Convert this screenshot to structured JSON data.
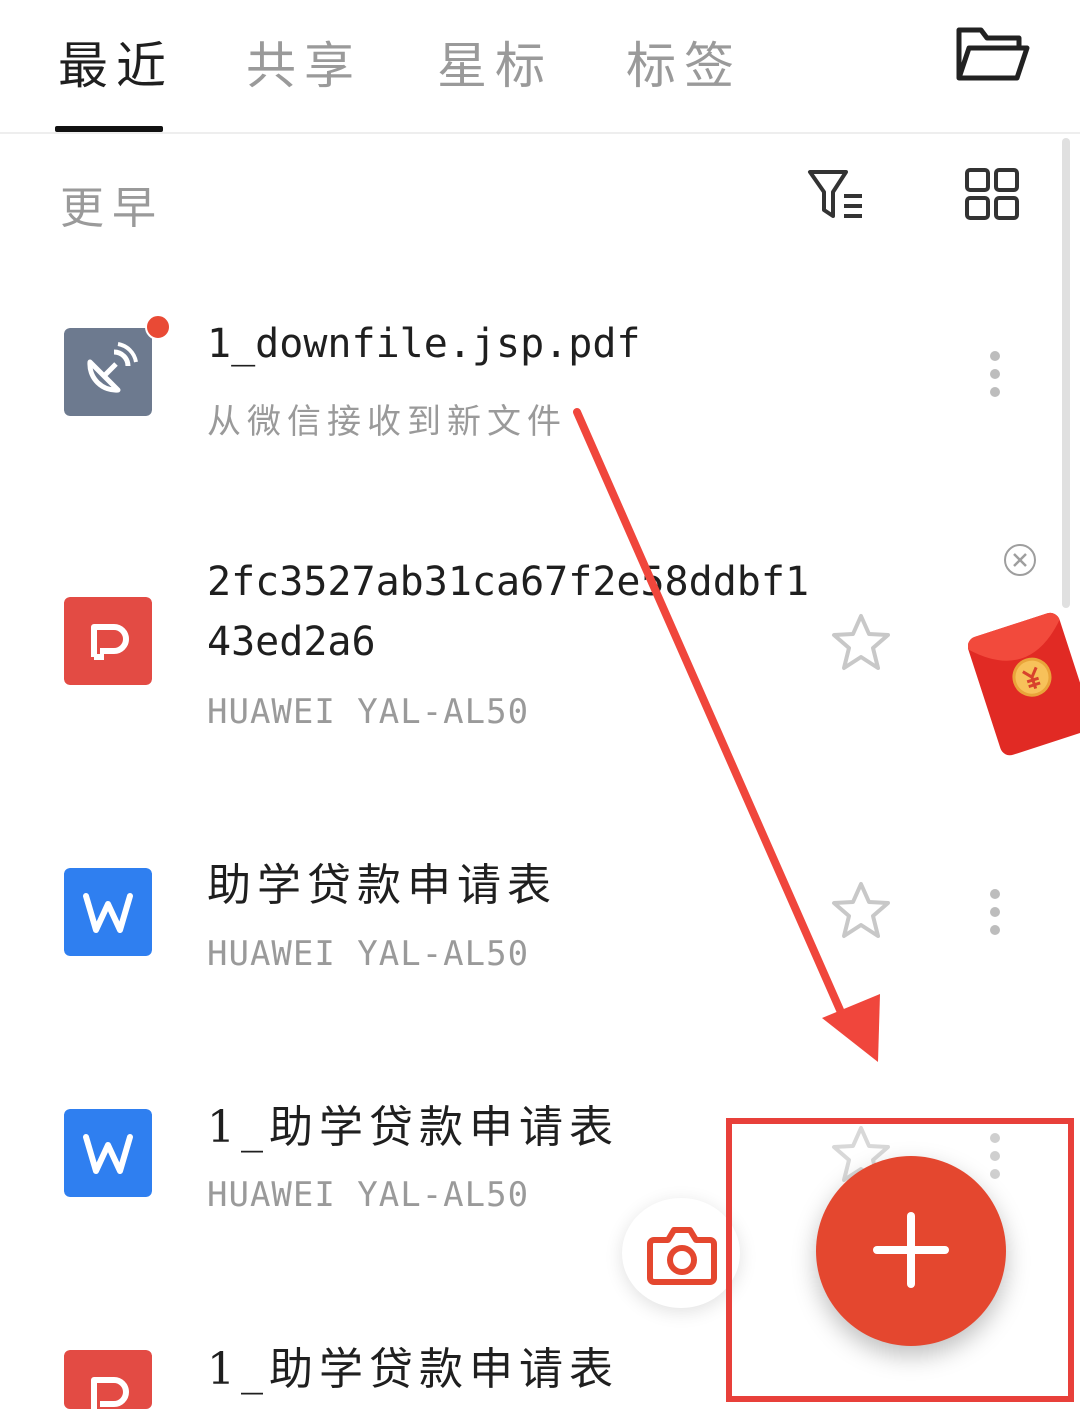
{
  "tabs": [
    {
      "label": "最近",
      "active": true
    },
    {
      "label": "共享",
      "active": false
    },
    {
      "label": "星标",
      "active": false
    },
    {
      "label": "标签",
      "active": false
    }
  ],
  "section": {
    "title": "更早"
  },
  "files": [
    {
      "name": "1_downfile.jsp.pdf",
      "subtitle": "从微信接收到新文件",
      "icon": "satellite-dish-icon",
      "icon_color": "#6d7a8f",
      "unread": true
    },
    {
      "name": "2fc3527ab31ca67f2e58ddbf1\n43ed2a6",
      "subtitle": "HUAWEI YAL-AL50",
      "icon": "ppt-icon",
      "icon_color": "#e34b44"
    },
    {
      "name": "助学贷款申请表",
      "subtitle": "HUAWEI YAL-AL50",
      "icon": "word-icon",
      "icon_color": "#2f7ff0"
    },
    {
      "name": "1_助学贷款申请表",
      "subtitle": "HUAWEI YAL-AL50",
      "icon": "word-icon",
      "icon_color": "#2f7ff0"
    },
    {
      "name": "1_助学贷款申请表",
      "subtitle": "",
      "icon": "ppt-icon",
      "icon_color": "#e34b44"
    }
  ],
  "colors": {
    "accent": "#e4472f",
    "annotation": "#e8403a",
    "muted_text": "#9a9a9a"
  },
  "icons": {
    "folder": "folder-icon",
    "filter": "filter-list-icon",
    "grid": "grid-view-icon",
    "star": "star-outline-icon",
    "more": "more-vertical-icon",
    "camera": "camera-icon",
    "add": "plus-icon",
    "red_packet": "red-packet-icon"
  }
}
